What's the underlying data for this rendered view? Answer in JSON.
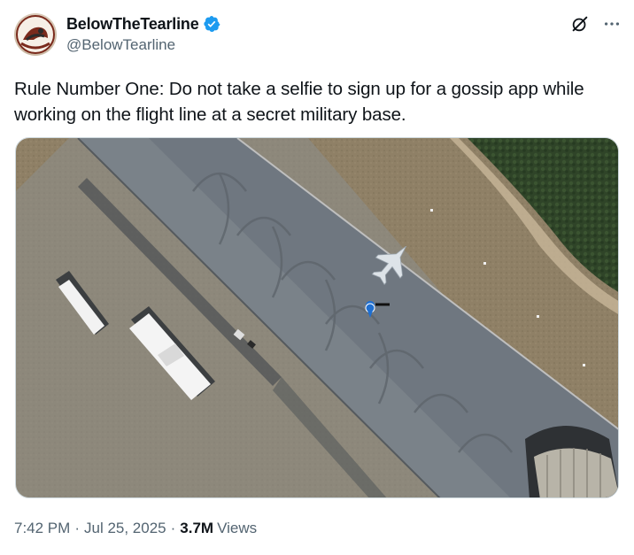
{
  "author": {
    "display_name": "BelowTheTearline",
    "handle": "@BelowTearline",
    "verified": true,
    "verified_color": "#1d9bf0"
  },
  "actions": {
    "grok_icon": "grok-slash-circle-icon",
    "more_icon": "more-dots-icon"
  },
  "tweet": {
    "text": "Rule Number One: Do not take a selfie to sign up for a gossip app while working on the flight line at a secret military base."
  },
  "media": {
    "alt": "Satellite image of a military flight line with a fighter jet and a location pin"
  },
  "meta": {
    "time": "7:42 PM",
    "separator": "·",
    "date": "Jul 25, 2025",
    "views_count": "3.7M",
    "views_label": "Views"
  }
}
